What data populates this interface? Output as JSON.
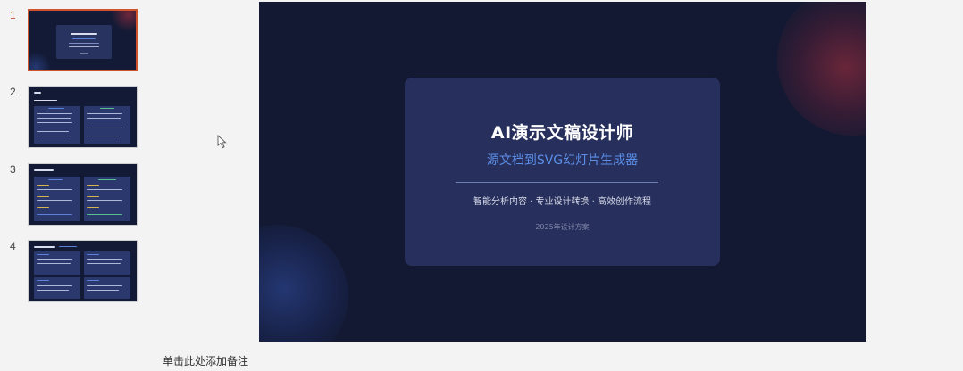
{
  "thumbnails": [
    {
      "number": "1",
      "active": true
    },
    {
      "number": "2",
      "active": false
    },
    {
      "number": "3",
      "active": false
    },
    {
      "number": "4",
      "active": false
    }
  ],
  "slide": {
    "title": "AI演示文稿设计师",
    "subtitle": "源文档到SVG幻灯片生成器",
    "tagline": "智能分析内容 · 专业设计转换 · 高效创作流程",
    "version": "2025年设计方案"
  },
  "notes": {
    "placeholder": "单击此处添加备注"
  },
  "colors": {
    "active_border": "#d0552f",
    "slide_bg": "#131932",
    "subtitle": "#5b8fe8"
  }
}
